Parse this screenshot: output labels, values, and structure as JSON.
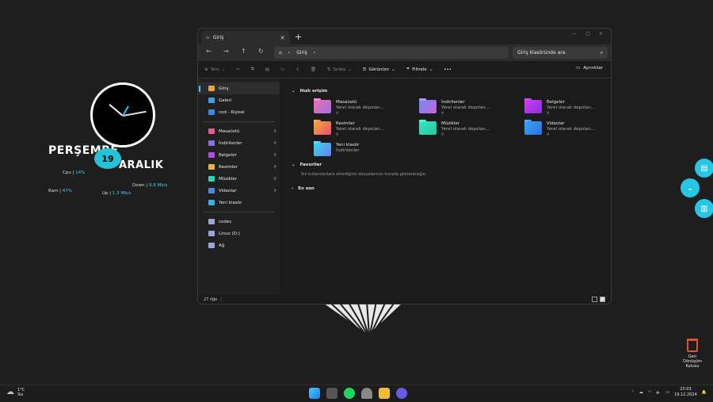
{
  "desktop": {
    "day": "PERŞEMBE",
    "date": "19",
    "month": "ARALIK",
    "stats": {
      "cpu_label": "Cpu",
      "cpu_value": "14%",
      "ram_label": "Ram",
      "ram_value": "47%",
      "down_label": "Down",
      "down_value": "9.8 Mb/s",
      "up_label": "Up",
      "up_value": "1.3 Mb/s"
    },
    "recycle_bin": "Geri Dönüşüm Kutusu"
  },
  "window": {
    "tab_title": "Giriş",
    "address": "Giriş",
    "search_placeholder": "Giriş klasöründe ara",
    "commands": {
      "new": "Yeni",
      "sort": "Sırala",
      "view": "Görünüm",
      "filter": "Filtrele",
      "more": "•••",
      "details": "Ayrıntılar"
    },
    "sidebar": [
      {
        "label": "Giriş",
        "icon": "home-icon",
        "color": "#e8a33c",
        "active": true
      },
      {
        "label": "Galeri",
        "icon": "gallery-icon",
        "color": "#3aa0e8"
      },
      {
        "label": "cod - Kişisel",
        "icon": "onedrive-icon",
        "color": "#3a8be8"
      }
    ],
    "sidebar_pinned": [
      {
        "label": "Masaüstü",
        "icon": "desktop-icon",
        "color": "#e05a9c"
      },
      {
        "label": "İndirilenler",
        "icon": "download-icon",
        "color": "#8a6ee8"
      },
      {
        "label": "Belgeler",
        "icon": "document-icon",
        "color": "#b04de8"
      },
      {
        "label": "Resimler",
        "icon": "pictures-icon",
        "color": "#e8b43c"
      },
      {
        "label": "Müzikler",
        "icon": "music-icon",
        "color": "#2ad4b0"
      },
      {
        "label": "Videolar",
        "icon": "video-icon",
        "color": "#4a8be8"
      },
      {
        "label": "Yeni klasör",
        "icon": "folder-icon",
        "color": "#3ab0e8"
      }
    ],
    "sidebar_drives": [
      {
        "label": "codes",
        "icon": "pc-icon",
        "color": "#9aa4d8"
      },
      {
        "label": "Linux (D:)",
        "icon": "drive-icon",
        "color": "#9aa4d8"
      },
      {
        "label": "Ağ",
        "icon": "network-icon",
        "color": "#9aa4d8"
      }
    ],
    "quick_access_title": "Hızlı erişim",
    "quick_access": [
      {
        "name": "Masaüstü",
        "sub": "Yerel olarak depolan...",
        "pin": true,
        "c1": "#f06eaa",
        "c2": "#a26ee8"
      },
      {
        "name": "İndirilenler",
        "sub": "Yerel olarak depolan...",
        "pin": true,
        "c1": "#6a8ef0",
        "c2": "#d05ee0"
      },
      {
        "name": "Belgeler",
        "sub": "Yerel olarak depolan...",
        "pin": true,
        "c1": "#d03ef0",
        "c2": "#8a2ee0"
      },
      {
        "name": "Resimler",
        "sub": "Yerel olarak depolan...",
        "pin": true,
        "c1": "#f0b030",
        "c2": "#f04a7a"
      },
      {
        "name": "Müzikler",
        "sub": "Yerel olarak depolan...",
        "pin": true,
        "c1": "#30e8c0",
        "c2": "#28c8a0"
      },
      {
        "name": "Videolar",
        "sub": "Yerel olarak depolan...",
        "pin": true,
        "c1": "#3aa8f0",
        "c2": "#2a6ee8"
      },
      {
        "name": "Yeni klasör",
        "sub": "İndirilenler",
        "pin": false,
        "c1": "#3ad8e8",
        "c2": "#6a7ef0"
      }
    ],
    "favorites_title": "Favoriler",
    "favorites_empty": "Sık kullanılanlara eklediğiniz dosyalarınızı burada göstereceğiz.",
    "recent_title": "En son",
    "status_count": "27 öğe"
  },
  "taskbar": {
    "temp": "1°C",
    "weather_desc": "Sis",
    "time": "23:03",
    "date": "19.12.2024"
  }
}
